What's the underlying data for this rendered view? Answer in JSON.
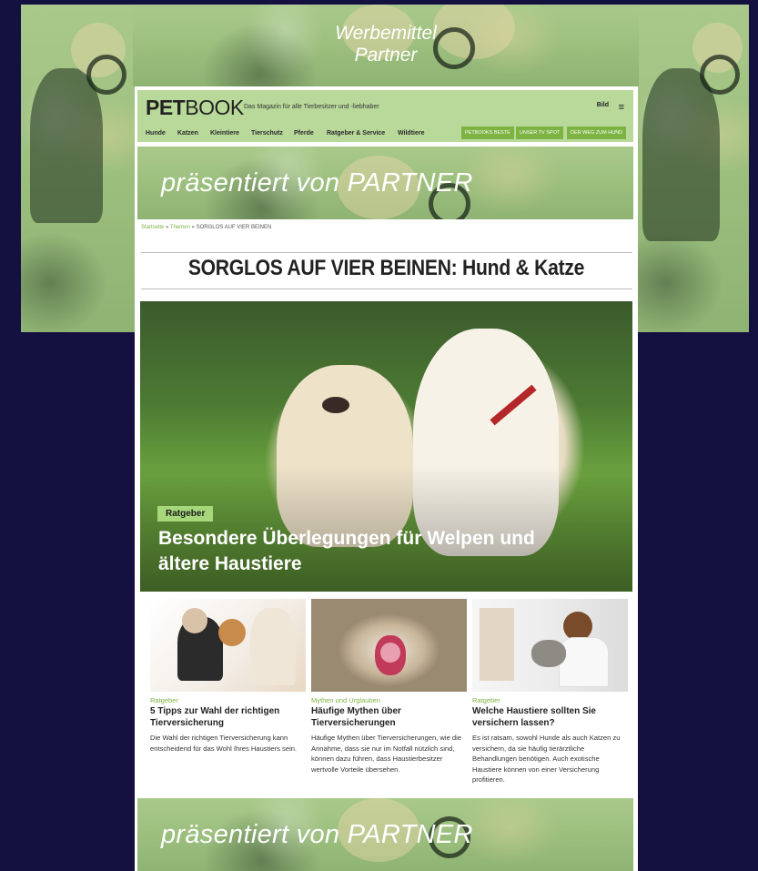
{
  "ad_header": {
    "line1": "Werbemittel",
    "line2": "Partner"
  },
  "site": {
    "logo_bold": "PET",
    "logo_light": "BOOK",
    "tagline": "Das Magazin für alle Tierbesitzer und -liebhaber",
    "brand_badge": "Bild",
    "nav": [
      "Hunde",
      "Katzen",
      "Kleintiere",
      "Tierschutz",
      "Pferde",
      "Ratgeber & Service",
      "Wildtiere"
    ],
    "nav_buttons": [
      "PETBOOKS BESTE",
      "UNSER TV SPOT",
      "DER WEG ZUM HUND"
    ]
  },
  "banner_top": {
    "text": "präsentiert von PARTNER"
  },
  "banner_bottom": {
    "text": "präsentiert von PARTNER"
  },
  "breadcrumb": {
    "home": "Startseite",
    "sep1": " » ",
    "themen": "Themen",
    "sep2": " » ",
    "current": "SORGLOS AUF VIER BEINEN"
  },
  "page_heading": "SORGLOS AUF VIER BEINEN: Hund & Katze",
  "hero": {
    "tag": "Ratgeber",
    "title": "Besondere Überlegungen für Welpen und ältere Haustiere"
  },
  "cards": [
    {
      "category": "Ratgeber",
      "title": "5 Tipps zur Wahl der richtigen Tierversicherung",
      "desc": "Die Wahl der richtigen Tierversicherung kann entscheidend für das Wohl Ihres Haustiers sein."
    },
    {
      "category": "Mythen und Urglauben",
      "title": "Häufige Mythen über Tierversicherungen",
      "desc": "Häufige Mythen über Tierversicherungen, wie die Annahme, dass sie nur im Notfall nützlich sind, können dazu führen, dass Haustierbesitzer wertvolle Vorteile übersehen."
    },
    {
      "category": "Ratgeber",
      "title": "Welche Haustiere sollten Sie versichern lassen?",
      "desc": "Es ist ratsam, sowohl Hunde als auch Katzen zu versichern, da sie häufig tierärztliche Behandlungen benötigen. Auch exotische Haustiere können von einer Versicherung profitieren."
    }
  ]
}
